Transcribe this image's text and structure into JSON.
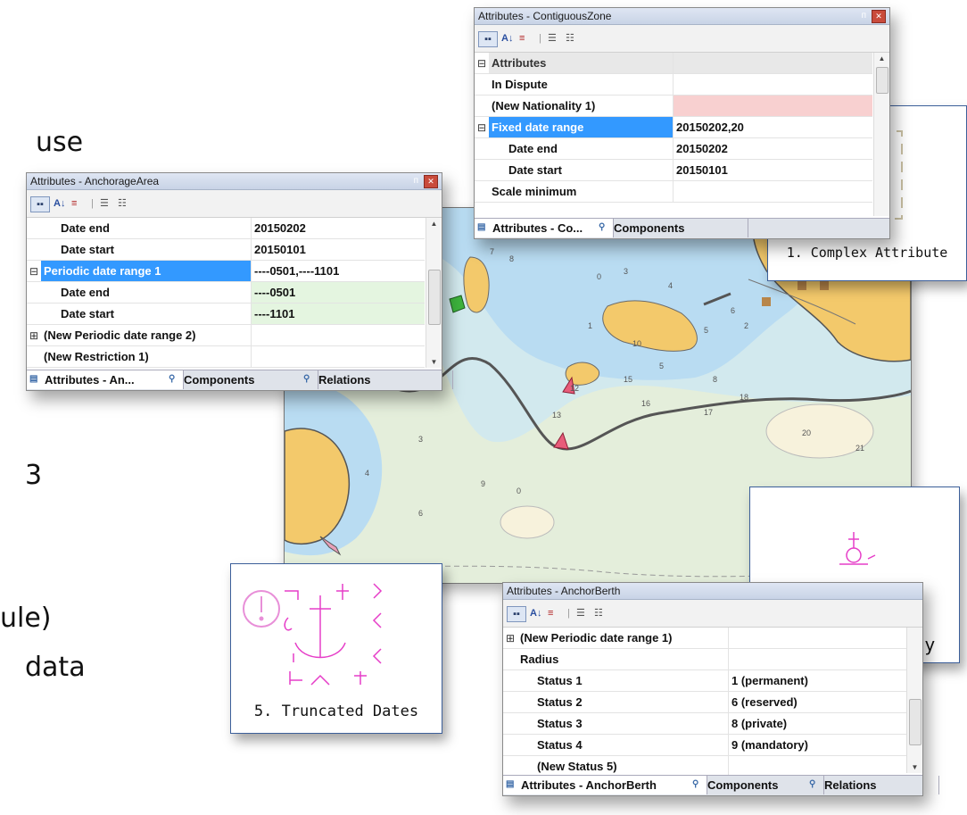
{
  "background_fragments": [
    "use",
    "3",
    "ule)",
    "data"
  ],
  "panels": {
    "contiguous": {
      "title": "Attributes - ContiguousZone",
      "rows": [
        {
          "expander": "⊟",
          "name": "Attributes",
          "value": ""
        },
        {
          "expander": "",
          "name": "In Dispute",
          "value": ""
        },
        {
          "expander": "",
          "name": "(New Nationality 1)",
          "value": ""
        },
        {
          "expander": "⊟",
          "name": "Fixed date range",
          "value": "20150202,20"
        },
        {
          "expander": "",
          "name": "Date end",
          "value": "20150202"
        },
        {
          "expander": "",
          "name": "Date start",
          "value": "20150101"
        },
        {
          "expander": "",
          "name": "Scale minimum",
          "value": ""
        }
      ],
      "tabs": [
        "Attributes - Co...",
        "Components"
      ]
    },
    "anchorage": {
      "title": "Attributes - AnchorageArea",
      "rows": [
        {
          "expander": "",
          "name": "Date end",
          "value": "20150202"
        },
        {
          "expander": "",
          "name": "Date start",
          "value": "20150101"
        },
        {
          "expander": "⊟",
          "name": "Periodic date range 1",
          "value": "----0501,----1101"
        },
        {
          "expander": "",
          "name": "Date end",
          "value": "----0501"
        },
        {
          "expander": "",
          "name": "Date start",
          "value": "----1101"
        },
        {
          "expander": "⊞",
          "name": "(New Periodic date range 2)",
          "value": ""
        },
        {
          "expander": "",
          "name": "(New Restriction 1)",
          "value": ""
        }
      ],
      "tabs": [
        "Attributes - An...",
        "Components",
        "Relations"
      ]
    },
    "berth": {
      "title": "Attributes - AnchorBerth",
      "rows": [
        {
          "expander": "⊞",
          "name": "(New Periodic date range 1)",
          "value": ""
        },
        {
          "expander": "",
          "name": "Radius",
          "value": ""
        },
        {
          "expander": "",
          "name": "Status 1",
          "value": "1 (permanent)"
        },
        {
          "expander": "",
          "name": "Status 2",
          "value": "6 (reserved)"
        },
        {
          "expander": "",
          "name": "Status 3",
          "value": "8 (private)"
        },
        {
          "expander": "",
          "name": "Status 4",
          "value": "9 (mandatory)"
        },
        {
          "expander": "",
          "name": "(New Status 5)",
          "value": ""
        }
      ],
      "tabs": [
        "Attributes - AnchorBerth",
        "Components",
        "Relations"
      ]
    }
  },
  "callouts": {
    "complex": "1. Complex Attribute",
    "multiplicity": "2. Multiplicity",
    "truncated": "5. Truncated Dates"
  },
  "map": {
    "soundings": [
      "7",
      "8",
      "9",
      "0",
      "3",
      "4",
      "5",
      "6",
      "2",
      "1",
      "10",
      "12",
      "13",
      "15",
      "16",
      "17",
      "18",
      "20",
      "21",
      "3",
      "4",
      "9",
      "0",
      "6",
      "8",
      "5"
    ]
  },
  "colors": {
    "selection": "#3399ff",
    "land": "#f3c96b",
    "shallow_water": "#b9dcf2",
    "medium_water": "#d2e9ee",
    "deep_water": "#e4eedb",
    "symbol_magenta": "#e63ec8"
  }
}
